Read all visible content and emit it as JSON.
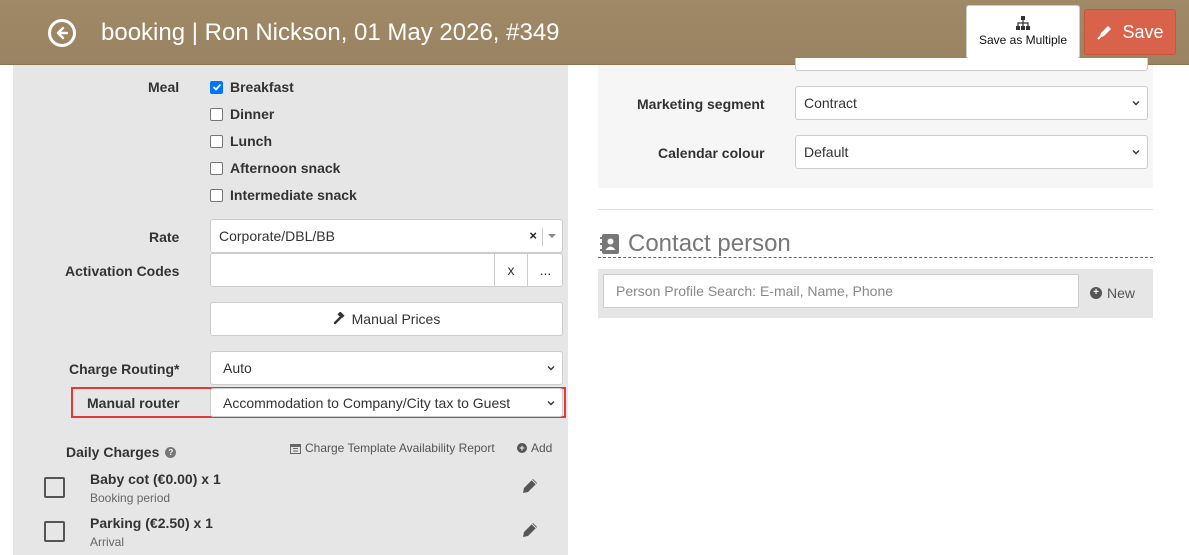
{
  "header": {
    "title": "booking | Ron Nickson, 01 May 2026, #349",
    "save_multiple_label": "Save as Multiple",
    "save_label": "Save"
  },
  "meal": {
    "label": "Meal",
    "options": [
      {
        "label": "Breakfast",
        "checked": true
      },
      {
        "label": "Dinner",
        "checked": false
      },
      {
        "label": "Lunch",
        "checked": false
      },
      {
        "label": "Afternoon snack",
        "checked": false
      },
      {
        "label": "Intermediate snack",
        "checked": false
      }
    ]
  },
  "rate": {
    "label": "Rate",
    "value": "Corporate/DBL/BB",
    "clear_glyph": "×"
  },
  "activation_codes": {
    "label": "Activation Codes",
    "value": "",
    "clear_label": "x",
    "more_label": "..."
  },
  "manual_prices": {
    "label": "Manual Prices",
    "icon": "gavel-icon"
  },
  "charge_routing": {
    "label": "Charge Routing*",
    "value": "Auto"
  },
  "manual_router": {
    "label": "Manual router",
    "value": "Accommodation to Company/City tax to Guest"
  },
  "daily_charges": {
    "label": "Daily Charges",
    "help_glyph": "?",
    "report_link": "Charge Template Availability Report",
    "add_link": "Add",
    "items": [
      {
        "title": "Baby cot (€0.00) x 1",
        "subtitle": "Booking period"
      },
      {
        "title": "Parking (€2.50) x 1",
        "subtitle": "Arrival"
      }
    ]
  },
  "marketing_segment": {
    "label": "Marketing segment",
    "value": "Contract"
  },
  "calendar_colour": {
    "label": "Calendar colour",
    "value": "Default"
  },
  "contact": {
    "title": "Contact person",
    "search_placeholder": "Person Profile Search: E-mail, Name, Phone",
    "new_label": "New"
  },
  "colors": {
    "header_bg": "#a08966",
    "save_bg": "#d9634a",
    "highlight": "#e53935",
    "panel_bg": "#e6e6e6"
  }
}
